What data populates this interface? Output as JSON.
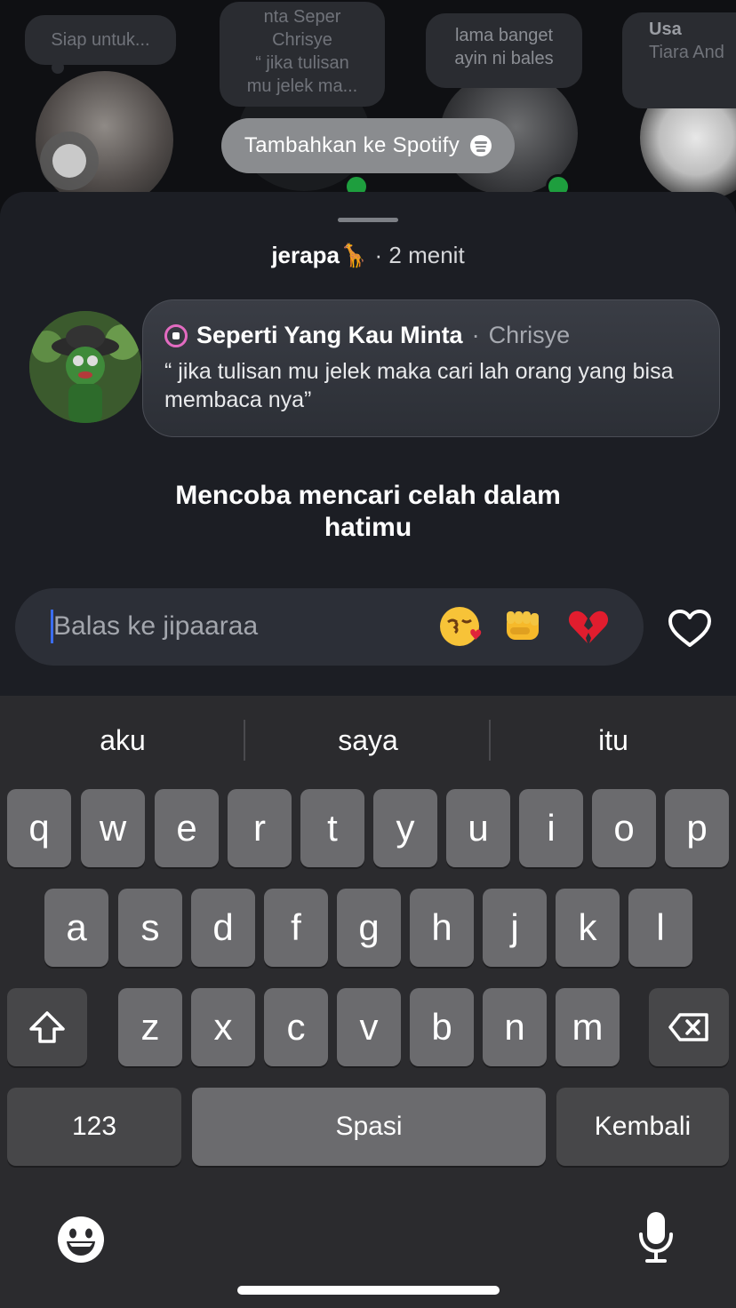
{
  "notes": [
    {
      "text": "Siap untuk..."
    },
    {
      "line1": "nta  Seper",
      "line2": "Chrisye",
      "line3": "“ jika tulisan",
      "line4": "mu jelek ma..."
    },
    {
      "line1": "lama banget",
      "line2": "ayin ni bales"
    },
    {
      "line1": "Usa",
      "line2": "Tiara And"
    }
  ],
  "spotify_pill": {
    "label": "Tambahkan ke Spotify"
  },
  "header": {
    "username": "jerapa🦒",
    "time": "· 2 menit"
  },
  "song": {
    "title": "Seperti Yang Kau Minta",
    "separator": "·",
    "artist": "Chrisye",
    "quote": "“ jika tulisan mu jelek maka cari lah orang yang bisa membaca nya”"
  },
  "caption": "Mencoba mencari celah dalam hatimu",
  "reply": {
    "placeholder": "Balas ke jipaaraa",
    "emojis": [
      "😘",
      "👊",
      "💔"
    ]
  },
  "keyboard": {
    "suggestions": [
      "aku",
      "saya",
      "itu"
    ],
    "row1": [
      "q",
      "w",
      "e",
      "r",
      "t",
      "y",
      "u",
      "i",
      "o",
      "p"
    ],
    "row2": [
      "a",
      "s",
      "d",
      "f",
      "g",
      "h",
      "j",
      "k",
      "l"
    ],
    "row3": [
      "z",
      "x",
      "c",
      "v",
      "b",
      "n",
      "m"
    ],
    "numbers_label": "123",
    "space_label": "Spasi",
    "return_label": "Kembali"
  }
}
